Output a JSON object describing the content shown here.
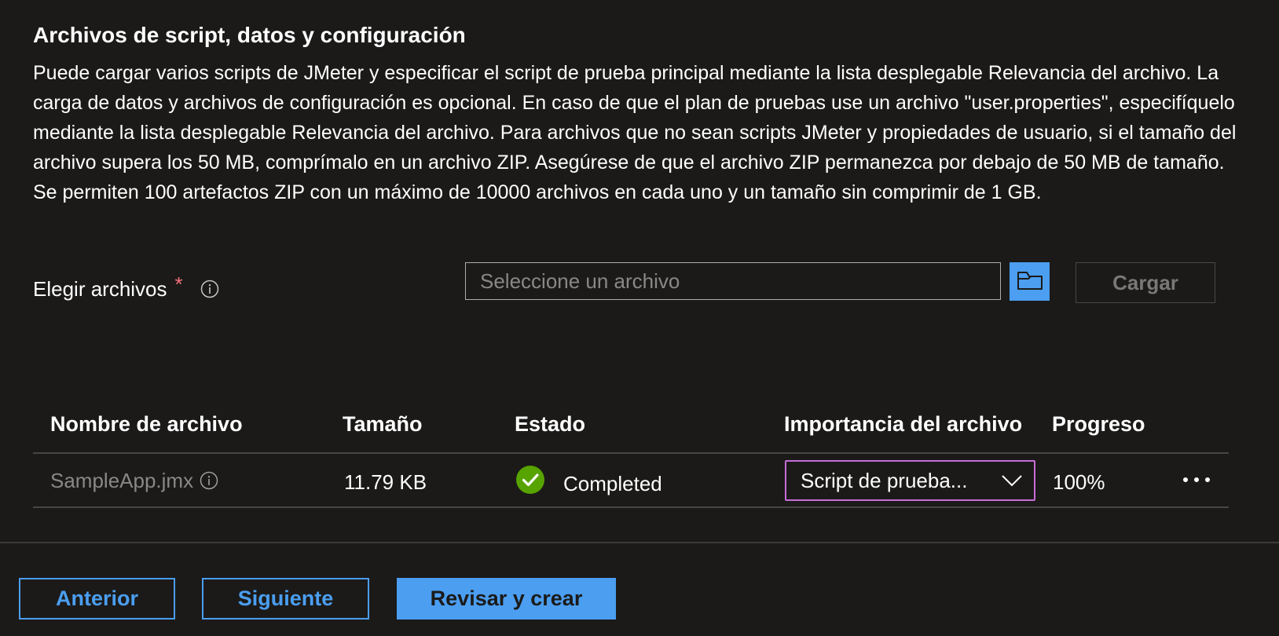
{
  "section": {
    "title": "Archivos de script, datos y configuración",
    "description": "Puede cargar varios scripts de JMeter y especificar el script de prueba principal mediante la lista desplegable Relevancia del archivo. La carga de datos y archivos de configuración es opcional. En caso de que el plan de pruebas use un archivo \"user.properties\", especifíquelo mediante la lista desplegable Relevancia del archivo. Para archivos que no sean scripts JMeter y propiedades de usuario, si el tamaño del archivo supera los 50 MB, comprímalo en un archivo ZIP. Asegúrese de que el archivo ZIP permanezca por debajo de 50 MB de tamaño. Se permiten 100 artefactos ZIP con un máximo de 10000 archivos en cada uno y un tamaño sin comprimir de 1 GB."
  },
  "file_picker": {
    "label": "Elegir archivos",
    "required_mark": "*",
    "placeholder": "Seleccione un archivo",
    "value": "",
    "upload_label": "Cargar",
    "browse_icon": "folder-icon",
    "info_icon": "info-icon"
  },
  "table": {
    "columns": [
      "Nombre de archivo",
      "Tamaño",
      "Estado",
      "Importancia del archivo",
      "Progreso"
    ],
    "rows": [
      {
        "file_name": "SampleApp.jmx",
        "size": "11.79 KB",
        "status": "Completed",
        "status_icon": "check-circle-icon",
        "importance": "Script de prueba...",
        "progress": "100%"
      }
    ]
  },
  "footer": {
    "previous_label": "Anterior",
    "next_label": "Siguiente",
    "review_label": "Revisar y crear"
  },
  "colors": {
    "background": "#1b1a19",
    "accent": "#4b9ef0",
    "success": "#57a300",
    "required": "#f1707b",
    "focus_border": "#c86dd7"
  }
}
